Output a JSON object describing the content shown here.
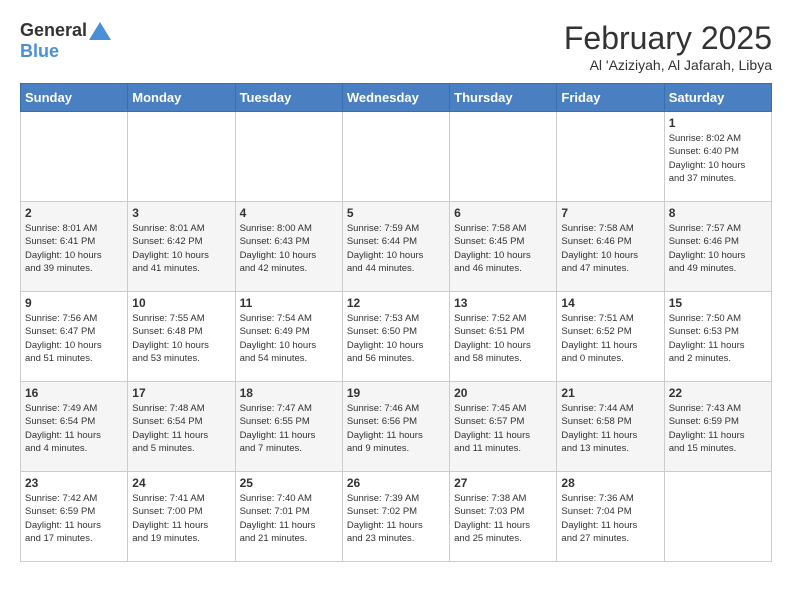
{
  "logo": {
    "general": "General",
    "blue": "Blue"
  },
  "title": "February 2025",
  "location": "Al 'Aziziyah, Al Jafarah, Libya",
  "headers": [
    "Sunday",
    "Monday",
    "Tuesday",
    "Wednesday",
    "Thursday",
    "Friday",
    "Saturday"
  ],
  "weeks": [
    [
      {
        "day": "",
        "detail": ""
      },
      {
        "day": "",
        "detail": ""
      },
      {
        "day": "",
        "detail": ""
      },
      {
        "day": "",
        "detail": ""
      },
      {
        "day": "",
        "detail": ""
      },
      {
        "day": "",
        "detail": ""
      },
      {
        "day": "1",
        "detail": "Sunrise: 8:02 AM\nSunset: 6:40 PM\nDaylight: 10 hours\nand 37 minutes."
      }
    ],
    [
      {
        "day": "2",
        "detail": "Sunrise: 8:01 AM\nSunset: 6:41 PM\nDaylight: 10 hours\nand 39 minutes."
      },
      {
        "day": "3",
        "detail": "Sunrise: 8:01 AM\nSunset: 6:42 PM\nDaylight: 10 hours\nand 41 minutes."
      },
      {
        "day": "4",
        "detail": "Sunrise: 8:00 AM\nSunset: 6:43 PM\nDaylight: 10 hours\nand 42 minutes."
      },
      {
        "day": "5",
        "detail": "Sunrise: 7:59 AM\nSunset: 6:44 PM\nDaylight: 10 hours\nand 44 minutes."
      },
      {
        "day": "6",
        "detail": "Sunrise: 7:58 AM\nSunset: 6:45 PM\nDaylight: 10 hours\nand 46 minutes."
      },
      {
        "day": "7",
        "detail": "Sunrise: 7:58 AM\nSunset: 6:46 PM\nDaylight: 10 hours\nand 47 minutes."
      },
      {
        "day": "8",
        "detail": "Sunrise: 7:57 AM\nSunset: 6:46 PM\nDaylight: 10 hours\nand 49 minutes."
      }
    ],
    [
      {
        "day": "9",
        "detail": "Sunrise: 7:56 AM\nSunset: 6:47 PM\nDaylight: 10 hours\nand 51 minutes."
      },
      {
        "day": "10",
        "detail": "Sunrise: 7:55 AM\nSunset: 6:48 PM\nDaylight: 10 hours\nand 53 minutes."
      },
      {
        "day": "11",
        "detail": "Sunrise: 7:54 AM\nSunset: 6:49 PM\nDaylight: 10 hours\nand 54 minutes."
      },
      {
        "day": "12",
        "detail": "Sunrise: 7:53 AM\nSunset: 6:50 PM\nDaylight: 10 hours\nand 56 minutes."
      },
      {
        "day": "13",
        "detail": "Sunrise: 7:52 AM\nSunset: 6:51 PM\nDaylight: 10 hours\nand 58 minutes."
      },
      {
        "day": "14",
        "detail": "Sunrise: 7:51 AM\nSunset: 6:52 PM\nDaylight: 11 hours\nand 0 minutes."
      },
      {
        "day": "15",
        "detail": "Sunrise: 7:50 AM\nSunset: 6:53 PM\nDaylight: 11 hours\nand 2 minutes."
      }
    ],
    [
      {
        "day": "16",
        "detail": "Sunrise: 7:49 AM\nSunset: 6:54 PM\nDaylight: 11 hours\nand 4 minutes."
      },
      {
        "day": "17",
        "detail": "Sunrise: 7:48 AM\nSunset: 6:54 PM\nDaylight: 11 hours\nand 5 minutes."
      },
      {
        "day": "18",
        "detail": "Sunrise: 7:47 AM\nSunset: 6:55 PM\nDaylight: 11 hours\nand 7 minutes."
      },
      {
        "day": "19",
        "detail": "Sunrise: 7:46 AM\nSunset: 6:56 PM\nDaylight: 11 hours\nand 9 minutes."
      },
      {
        "day": "20",
        "detail": "Sunrise: 7:45 AM\nSunset: 6:57 PM\nDaylight: 11 hours\nand 11 minutes."
      },
      {
        "day": "21",
        "detail": "Sunrise: 7:44 AM\nSunset: 6:58 PM\nDaylight: 11 hours\nand 13 minutes."
      },
      {
        "day": "22",
        "detail": "Sunrise: 7:43 AM\nSunset: 6:59 PM\nDaylight: 11 hours\nand 15 minutes."
      }
    ],
    [
      {
        "day": "23",
        "detail": "Sunrise: 7:42 AM\nSunset: 6:59 PM\nDaylight: 11 hours\nand 17 minutes."
      },
      {
        "day": "24",
        "detail": "Sunrise: 7:41 AM\nSunset: 7:00 PM\nDaylight: 11 hours\nand 19 minutes."
      },
      {
        "day": "25",
        "detail": "Sunrise: 7:40 AM\nSunset: 7:01 PM\nDaylight: 11 hours\nand 21 minutes."
      },
      {
        "day": "26",
        "detail": "Sunrise: 7:39 AM\nSunset: 7:02 PM\nDaylight: 11 hours\nand 23 minutes."
      },
      {
        "day": "27",
        "detail": "Sunrise: 7:38 AM\nSunset: 7:03 PM\nDaylight: 11 hours\nand 25 minutes."
      },
      {
        "day": "28",
        "detail": "Sunrise: 7:36 AM\nSunset: 7:04 PM\nDaylight: 11 hours\nand 27 minutes."
      },
      {
        "day": "",
        "detail": ""
      }
    ]
  ]
}
